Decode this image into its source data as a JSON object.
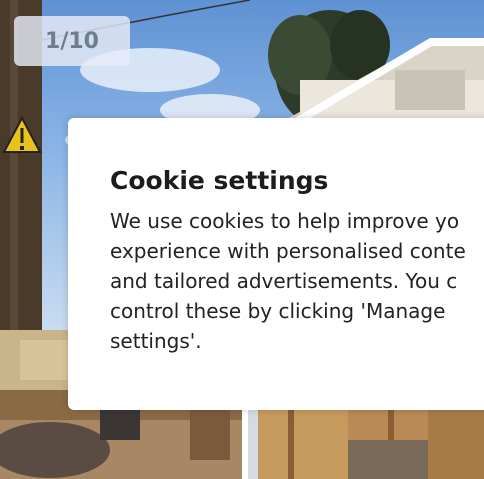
{
  "gallery": {
    "counter": "1/10",
    "images": [
      {
        "icon": "house-exterior-photo"
      },
      {
        "icon": "living-room-photo"
      },
      {
        "icon": "interior-room-photo"
      }
    ]
  },
  "cookie_banner": {
    "title": "Cookie settings",
    "lines": [
      "We use cookies to help improve yo",
      "experience with personalised conte",
      "and tailored advertisements. You c",
      "control these by clicking 'Manage",
      "settings'."
    ]
  }
}
